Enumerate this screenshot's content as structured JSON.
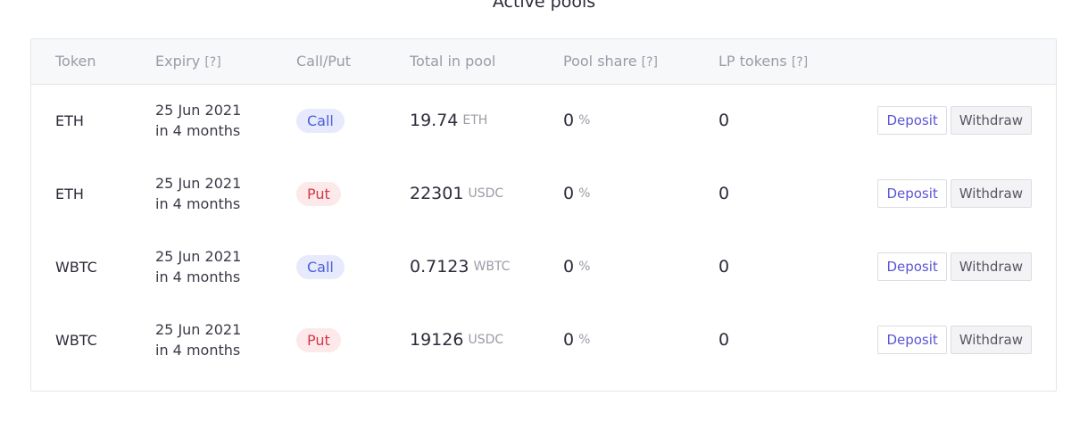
{
  "page_title": "Active pools",
  "table": {
    "headers": {
      "token": "Token",
      "expiry": "Expiry",
      "expiry_help": "[?]",
      "call_put": "Call/Put",
      "total_in_pool": "Total in pool",
      "pool_share": "Pool share",
      "pool_share_help": "[?]",
      "lp_tokens": "LP tokens",
      "lp_tokens_help": "[?]"
    },
    "rows": [
      {
        "token": "ETH",
        "expiry_date": "25 Jun 2021",
        "expiry_relative": "in 4 months",
        "type": "Call",
        "total_amount": "19.74",
        "total_unit": "ETH",
        "pool_share": "0",
        "pool_share_unit": "%",
        "lp_tokens": "0",
        "deposit_label": "Deposit",
        "withdraw_label": "Withdraw"
      },
      {
        "token": "ETH",
        "expiry_date": "25 Jun 2021",
        "expiry_relative": "in 4 months",
        "type": "Put",
        "total_amount": "22301",
        "total_unit": "USDC",
        "pool_share": "0",
        "pool_share_unit": "%",
        "lp_tokens": "0",
        "deposit_label": "Deposit",
        "withdraw_label": "Withdraw"
      },
      {
        "token": "WBTC",
        "expiry_date": "25 Jun 2021",
        "expiry_relative": "in 4 months",
        "type": "Call",
        "total_amount": "0.7123",
        "total_unit": "WBTC",
        "pool_share": "0",
        "pool_share_unit": "%",
        "lp_tokens": "0",
        "deposit_label": "Deposit",
        "withdraw_label": "Withdraw"
      },
      {
        "token": "WBTC",
        "expiry_date": "25 Jun 2021",
        "expiry_relative": "in 4 months",
        "type": "Put",
        "total_amount": "19126",
        "total_unit": "USDC",
        "pool_share": "0",
        "pool_share_unit": "%",
        "lp_tokens": "0",
        "deposit_label": "Deposit",
        "withdraw_label": "Withdraw"
      }
    ]
  },
  "colors": {
    "call_bg": "#e6eafc",
    "call_text": "#4c5fd6",
    "put_bg": "#fde8ea",
    "put_text": "#d23a49",
    "deposit_text": "#5a55d6"
  }
}
